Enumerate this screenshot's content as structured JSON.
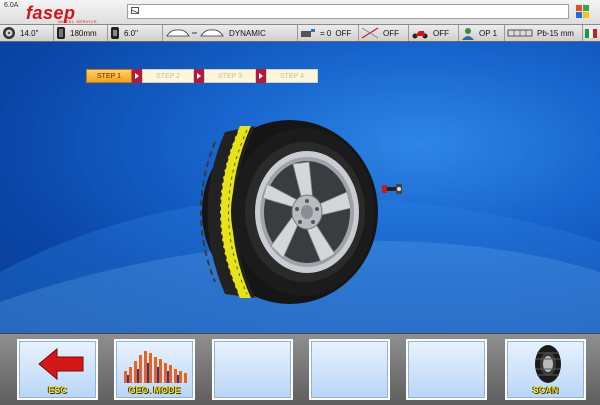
{
  "app": {
    "version": "6.0A",
    "logo_text": "fasep",
    "logo_subtext": "WHEEL SERVICE",
    "message": ""
  },
  "status": {
    "rim_diameter": "14.0\"",
    "rim_width": "180mm",
    "rim_size": "6.0\"",
    "balance_mode": "DYNAMIC",
    "rounding": "= 0",
    "rounding_state": "OFF",
    "cal_state": "OFF",
    "moto_state": "OFF",
    "operator": "OP 1",
    "weight_type": "Pb-15 mm",
    "language_flag": "italy-flag-icon"
  },
  "steps": [
    {
      "label": "STEP 1",
      "active": true
    },
    {
      "label": "STEP 2",
      "active": false
    },
    {
      "label": "STEP 3",
      "active": false
    },
    {
      "label": "STEP 4",
      "active": false
    }
  ],
  "buttons": {
    "esc": "ESC",
    "geo_mode": "GEO. MODE",
    "scan": "SCAN"
  },
  "colors": {
    "brand": "#d4121a",
    "accent_step": "#f5a21a",
    "button_label": "#ffe600",
    "background": "#0b47a8"
  }
}
